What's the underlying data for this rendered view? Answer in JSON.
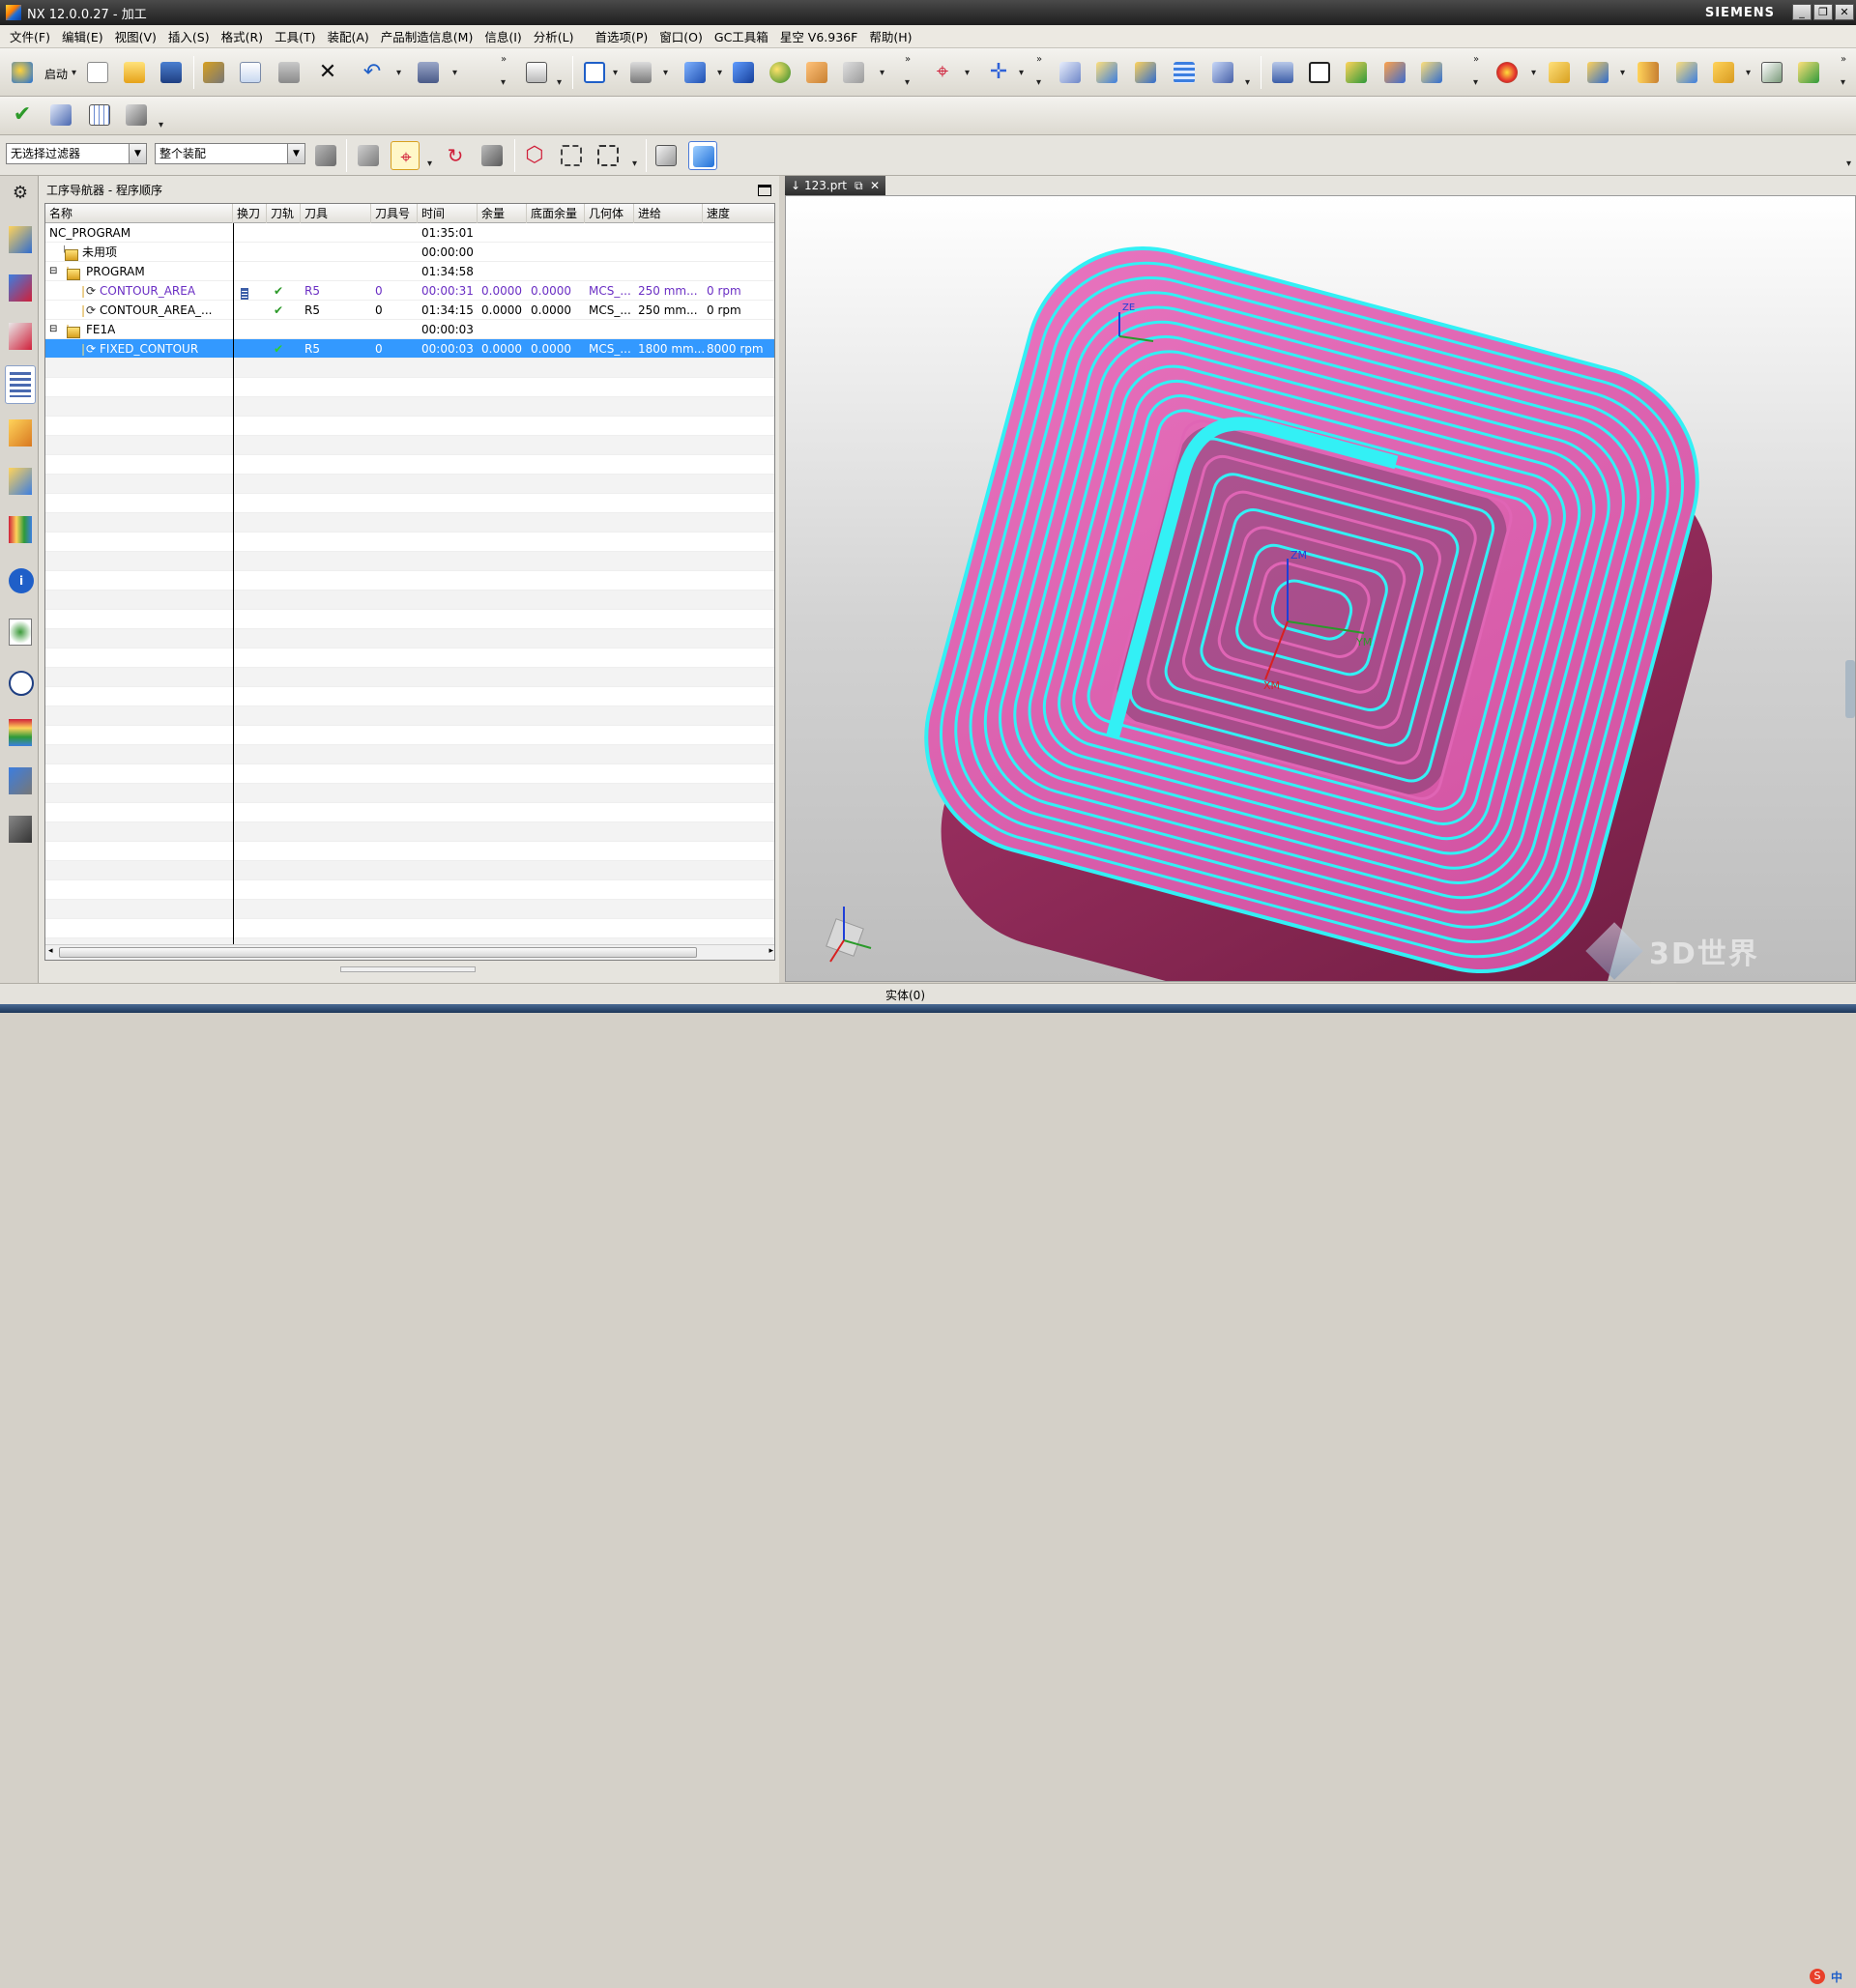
{
  "window": {
    "title": "NX 12.0.0.27 - 加工",
    "brand": "SIEMENS"
  },
  "menu": [
    "文件(F)",
    "编辑(E)",
    "视图(V)",
    "插入(S)",
    "格式(R)",
    "工具(T)",
    "装配(A)",
    "产品制造信息(M)",
    "信息(I)",
    "分析(L)",
    "首选项(P)",
    "窗口(O)",
    "GC工具箱",
    "星空 V6.936F",
    "帮助(H)"
  ],
  "toolbar": {
    "start_label": "启动"
  },
  "filters": {
    "selection_filter": "无选择过滤器",
    "scope": "整个装配"
  },
  "navigator": {
    "title": "工序导航器 - 程序顺序",
    "columns": [
      "名称",
      "换刀",
      "刀轨",
      "刀具",
      "刀具号",
      "时间",
      "余量",
      "底面余量",
      "几何体",
      "进给",
      "速度"
    ],
    "rows": [
      {
        "name": "NC_PROGRAM",
        "tool": "",
        "toolno": "",
        "time": "01:35:01",
        "stock": "",
        "floor": "",
        "geom": "",
        "feed": "",
        "speed": ""
      },
      {
        "name": "未用项",
        "tool": "",
        "toolno": "",
        "time": "00:00:00",
        "stock": "",
        "floor": "",
        "geom": "",
        "feed": "",
        "speed": ""
      },
      {
        "name": "PROGRAM",
        "tool": "",
        "toolno": "",
        "time": "01:34:58",
        "stock": "",
        "floor": "",
        "geom": "",
        "feed": "",
        "speed": ""
      },
      {
        "name": "CONTOUR_AREA",
        "tool": "R5",
        "toolno": "0",
        "time": "00:00:31",
        "stock": "0.0000",
        "floor": "0.0000",
        "geom": "MCS_...",
        "feed": "250 mm...",
        "speed": "0 rpm"
      },
      {
        "name": "CONTOUR_AREA_...",
        "tool": "R5",
        "toolno": "0",
        "time": "01:34:15",
        "stock": "0.0000",
        "floor": "0.0000",
        "geom": "MCS_...",
        "feed": "250 mm...",
        "speed": "0 rpm"
      },
      {
        "name": "FE1A",
        "tool": "",
        "toolno": "",
        "time": "00:00:03",
        "stock": "",
        "floor": "",
        "geom": "",
        "feed": "",
        "speed": ""
      },
      {
        "name": "FIXED_CONTOUR",
        "tool": "R5",
        "toolno": "0",
        "time": "00:00:03",
        "stock": "0.0000",
        "floor": "0.0000",
        "geom": "MCS_...",
        "feed": "1800 mm...",
        "speed": "8000 rpm"
      }
    ]
  },
  "viewport_tab": {
    "label": "123.prt"
  },
  "axes_labels": {
    "zm": "ZM",
    "xm": "XM",
    "ym": "YM",
    "ze": "ZE"
  },
  "status": {
    "text": "实体(0)"
  },
  "watermark": {
    "text": "3D世界网"
  },
  "ime": {
    "label": "中"
  },
  "colors": {
    "toolpath": "#33f0f5",
    "part_top": "#e065b5",
    "part_side": "#a0305f",
    "selection": "#3399ff",
    "accent": "#6b2fc4"
  }
}
